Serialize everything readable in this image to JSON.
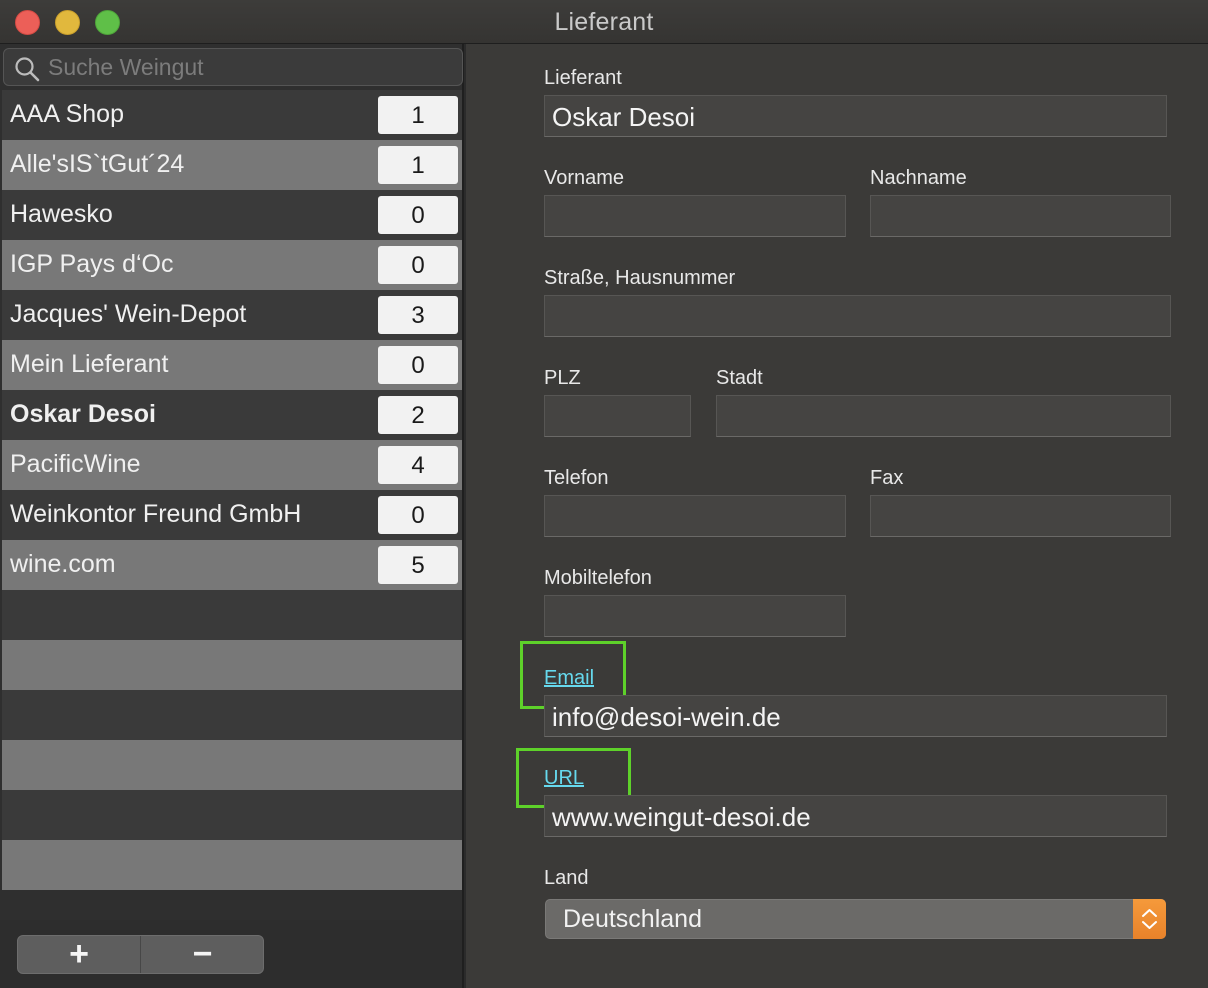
{
  "window": {
    "title": "Lieferant"
  },
  "sidebar": {
    "search_placeholder": "Suche Weingut",
    "items": [
      {
        "name": "AAA Shop",
        "count": "1"
      },
      {
        "name": "Alle'sIS`tGut´24",
        "count": "1"
      },
      {
        "name": "Hawesko",
        "count": "0"
      },
      {
        "name": "IGP Pays d‘Oc",
        "count": "0"
      },
      {
        "name": "Jacques' Wein-Depot",
        "count": "3"
      },
      {
        "name": "Mein Lieferant",
        "count": "0"
      },
      {
        "name": "Oskar Desoi",
        "count": "2"
      },
      {
        "name": "PacificWine",
        "count": "4"
      },
      {
        "name": "Weinkontor Freund GmbH",
        "count": "0"
      },
      {
        "name": "wine.com",
        "count": "5"
      }
    ],
    "selected_index": 6,
    "add_label": "+",
    "remove_label": "−"
  },
  "form": {
    "lieferant": {
      "label": "Lieferant",
      "value": "Oskar Desoi"
    },
    "vorname": {
      "label": "Vorname",
      "value": ""
    },
    "nachname": {
      "label": "Nachname",
      "value": ""
    },
    "strasse": {
      "label": "Straße, Hausnummer",
      "value": ""
    },
    "plz": {
      "label": "PLZ",
      "value": ""
    },
    "stadt": {
      "label": "Stadt",
      "value": ""
    },
    "telefon": {
      "label": "Telefon",
      "value": ""
    },
    "fax": {
      "label": "Fax",
      "value": ""
    },
    "mobiltelefon": {
      "label": "Mobiltelefon",
      "value": ""
    },
    "email": {
      "label": "Email",
      "value": "info@desoi-wein.de"
    },
    "url": {
      "label": "URL",
      "value": "www.weingut-desoi.de"
    },
    "land": {
      "label": "Land",
      "value": "Deutschland"
    }
  },
  "colors": {
    "close": "#ec5f58",
    "minimize": "#e1b83d",
    "maximize": "#5fbf48",
    "link": "#66d9ee",
    "highlight": "#5ed12a",
    "stepper": "#f08d33"
  }
}
